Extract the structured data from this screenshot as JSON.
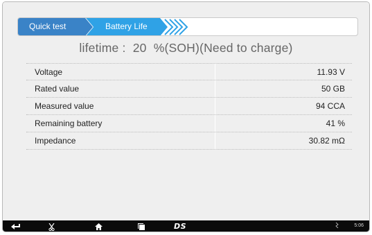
{
  "breadcrumb": {
    "items": [
      {
        "label": "Quick test"
      },
      {
        "label": "Battery Life"
      }
    ],
    "colors": {
      "first": "#3a83c7",
      "second": "#2fa2e6"
    }
  },
  "result": {
    "label": "lifetime :",
    "value": "20",
    "unit": "%(SOH)(Need to charge)"
  },
  "table": {
    "rows": [
      {
        "label": "Voltage",
        "value": "11.93 V"
      },
      {
        "label": "Rated value",
        "value": "50 GB"
      },
      {
        "label": "Measured value",
        "value": "94 CCA"
      },
      {
        "label": "Remaining battery",
        "value": "41 %"
      },
      {
        "label": "Impedance",
        "value": "30.82 mΩ"
      }
    ]
  },
  "navbar": {
    "icons": [
      "back-icon",
      "scissors-icon",
      "home-icon",
      "recent-apps-icon"
    ],
    "brand": "DS",
    "status_icon": "signal-icon",
    "clock": "5:06"
  }
}
